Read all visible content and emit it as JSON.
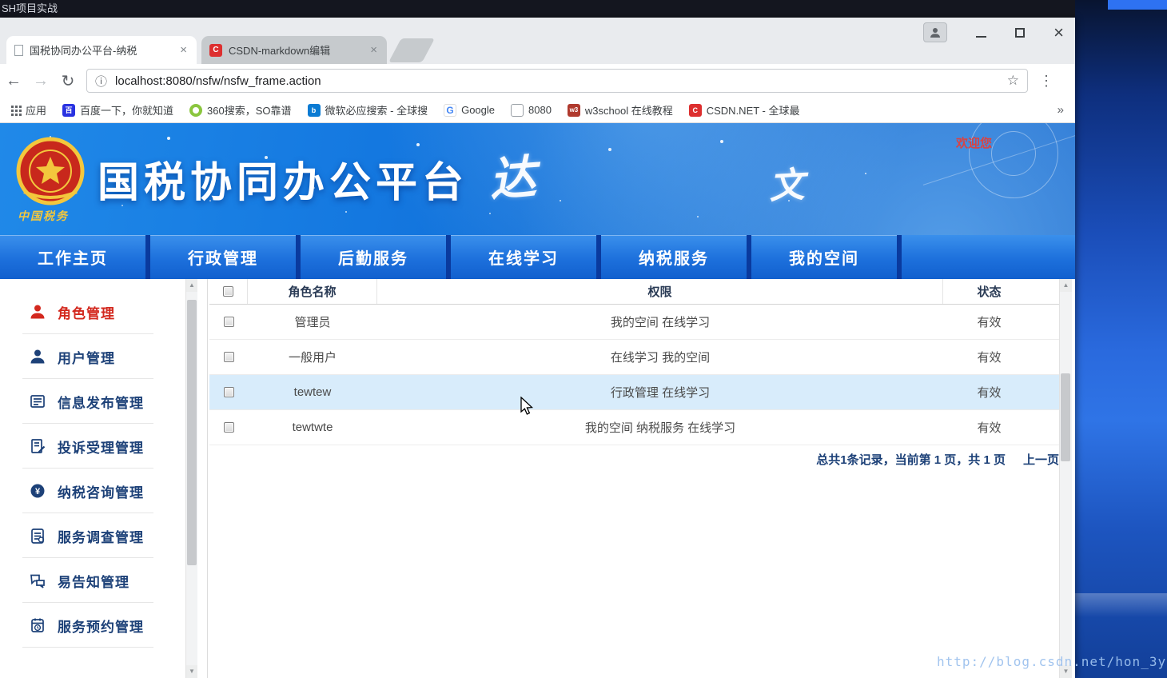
{
  "desktop": {
    "recording_title": "SH项目实战",
    "watermark": "http://blog.csdn.net/hon_3y"
  },
  "colors": {
    "banner_blue": "#1478e0",
    "nav_blue": "#1d70dc",
    "active_item_red": "#d3281e",
    "highlight_row_blue": "#d8ecfb",
    "welcome_red": "#d84444"
  },
  "browser": {
    "tabs": [
      {
        "title": "国税协同办公平台-纳税",
        "close": "×"
      },
      {
        "title": "CSDN-markdown编辑",
        "close": "×"
      }
    ],
    "window": {
      "close_glyph": "×"
    },
    "toolbar": {
      "back": "←",
      "forward": "→",
      "refresh": "↻",
      "info": "ⓘ",
      "star": "☆",
      "menu": "⋮",
      "url": "localhost:8080/nsfw/nsfw_frame.action"
    },
    "bookmarks": {
      "apps_label": "应用",
      "items": [
        {
          "label": "百度一下，你就知道",
          "fav": "百"
        },
        {
          "label": "360搜索，SO靠谱",
          "fav": ""
        },
        {
          "label": "微软必应搜索 - 全球搜",
          "fav": "b"
        },
        {
          "label": "Google",
          "fav": "G"
        },
        {
          "label": "8080",
          "fav": ""
        },
        {
          "label": "w3school 在线教程",
          "fav": "w3"
        },
        {
          "label": "CSDN.NET - 全球最",
          "fav": "C"
        }
      ],
      "overflow": "»"
    }
  },
  "page": {
    "banner": {
      "title": "国税协同办公平台",
      "logo_text": "中国税务",
      "welcome": "欢迎您",
      "deco_left": "达",
      "deco_right": "文"
    },
    "nav": {
      "items": [
        "工作主页",
        "行政管理",
        "后勤服务",
        "在线学习",
        "纳税服务",
        "我的空间"
      ]
    },
    "sidebar": {
      "items": [
        {
          "label": "角色管理"
        },
        {
          "label": "用户管理"
        },
        {
          "label": "信息发布管理"
        },
        {
          "label": "投诉受理管理"
        },
        {
          "label": "纳税咨询管理"
        },
        {
          "label": "服务调查管理"
        },
        {
          "label": "易告知管理"
        },
        {
          "label": "服务预约管理"
        }
      ]
    },
    "table": {
      "headers": {
        "name": "角色名称",
        "perm": "权限",
        "status": "状态"
      },
      "rows": [
        {
          "name": "管理员",
          "perm": "我的空间 在线学习",
          "status": "有效"
        },
        {
          "name": "一般用户",
          "perm": "在线学习 我的空间",
          "status": "有效"
        },
        {
          "name": "tewtew",
          "perm": "行政管理 在线学习",
          "status": "有效"
        },
        {
          "name": "tewtwte",
          "perm": "我的空间 纳税服务 在线学习",
          "status": "有效"
        }
      ],
      "pagination": "总共1条记录，当前第 1 页，共 1 页",
      "prev": "上一页"
    }
  }
}
